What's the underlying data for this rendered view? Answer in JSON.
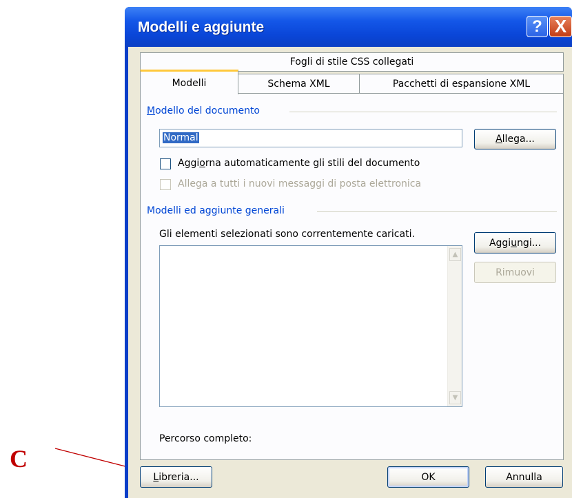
{
  "callout": {
    "letter": "C"
  },
  "window": {
    "title": "Modelli e aggiunte",
    "help_icon": "help-icon",
    "close_icon": "close-icon",
    "help_glyph": "?",
    "close_glyph": "X"
  },
  "tabs": {
    "row_top": [
      "Fogli di stile CSS collegati"
    ],
    "row_bottom": [
      "Modelli",
      "Schema XML",
      "Pacchetti di espansione XML"
    ],
    "active": "Modelli"
  },
  "document_template": {
    "group_label": "Modello del documento",
    "value": "Normal",
    "attach_button": "Allega...",
    "auto_update_label": "Aggiorna automaticamente gli stili del documento",
    "auto_update_checked": false,
    "attach_all_label": "Allega a tutti i nuovi messaggi di posta elettronica",
    "attach_all_enabled": false
  },
  "global_templates": {
    "group_label": "Modelli ed aggiunte generali",
    "description": "Gli elementi selezionati sono correntemente caricati.",
    "items": [],
    "add_button": "Aggiungi...",
    "remove_button": "Rimuovi",
    "full_path_label": "Percorso completo:"
  },
  "footer": {
    "library_button": "Libreria...",
    "ok_button": "OK",
    "cancel_button": "Annulla"
  },
  "colors": {
    "titlebar": "#0a46d8",
    "dialog_face": "#ece9d8",
    "group_label": "#0046d5",
    "callout": "#c00000"
  }
}
